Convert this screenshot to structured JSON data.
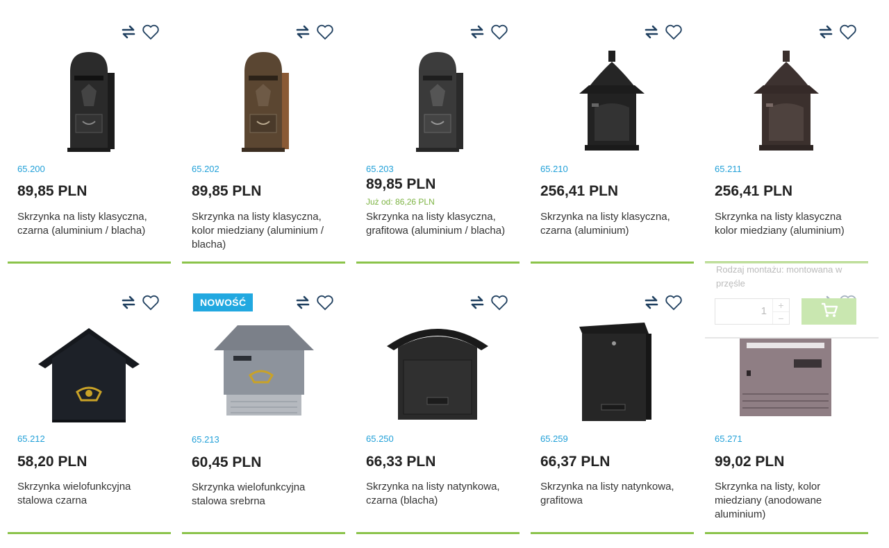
{
  "colors": {
    "accent_green": "#8bc34a",
    "code_blue": "#21a0d8",
    "badge_blue": "#21a8e0",
    "icon_dark": "#1f3f5f"
  },
  "icons": {
    "compare": "compare-arrows-icon",
    "wishlist": "heart-outline-icon",
    "cart": "cart-icon"
  },
  "products": [
    {
      "code": "65.200",
      "price": "89,85 PLN",
      "from": "",
      "name": "Skrzynka na listy klasyczna, czarna (aluminium / blacha)",
      "badge": ""
    },
    {
      "code": "65.202",
      "price": "89,85 PLN",
      "from": "",
      "name": "Skrzynka na listy klasyczna, kolor miedziany (aluminium / blacha)",
      "badge": ""
    },
    {
      "code": "65.203",
      "price": "89,85 PLN",
      "from": "Już od: 86,26 PLN",
      "name": "Skrzynka na listy klasyczna, grafitowa (aluminium / blacha)",
      "badge": ""
    },
    {
      "code": "65.210",
      "price": "256,41 PLN",
      "from": "",
      "name": "Skrzynka na listy klasyczna, czarna (aluminium)",
      "badge": ""
    },
    {
      "code": "65.211",
      "price": "256,41 PLN",
      "from": "",
      "name": "Skrzynka na listy klasyczna kolor miedziany (aluminium)",
      "badge": ""
    },
    {
      "code": "65.212",
      "price": "58,20 PLN",
      "from": "",
      "name": "Skrzynka wielofunkcyjna stalowa czarna",
      "badge": ""
    },
    {
      "code": "65.213",
      "price": "60,45 PLN",
      "from": "",
      "name": "Skrzynka wielofunkcyjna stalowa srebrna",
      "badge": "NOWOŚĆ"
    },
    {
      "code": "65.250",
      "price": "66,33 PLN",
      "from": "",
      "name": "Skrzynka na listy natynkowa, czarna (blacha)",
      "badge": ""
    },
    {
      "code": "65.259",
      "price": "66,37 PLN",
      "from": "",
      "name": "Skrzynka na listy natynkowa, grafitowa",
      "badge": ""
    },
    {
      "code": "65.271",
      "price": "99,02 PLN",
      "from": "",
      "name": "Skrzynka na listy, kolor miedziany (anodowane aluminium)",
      "badge": ""
    }
  ],
  "hover_panel": {
    "attribute": "Rodzaj montażu: montowana w przęśle",
    "quantity": "1",
    "plus": "+",
    "minus": "−"
  }
}
